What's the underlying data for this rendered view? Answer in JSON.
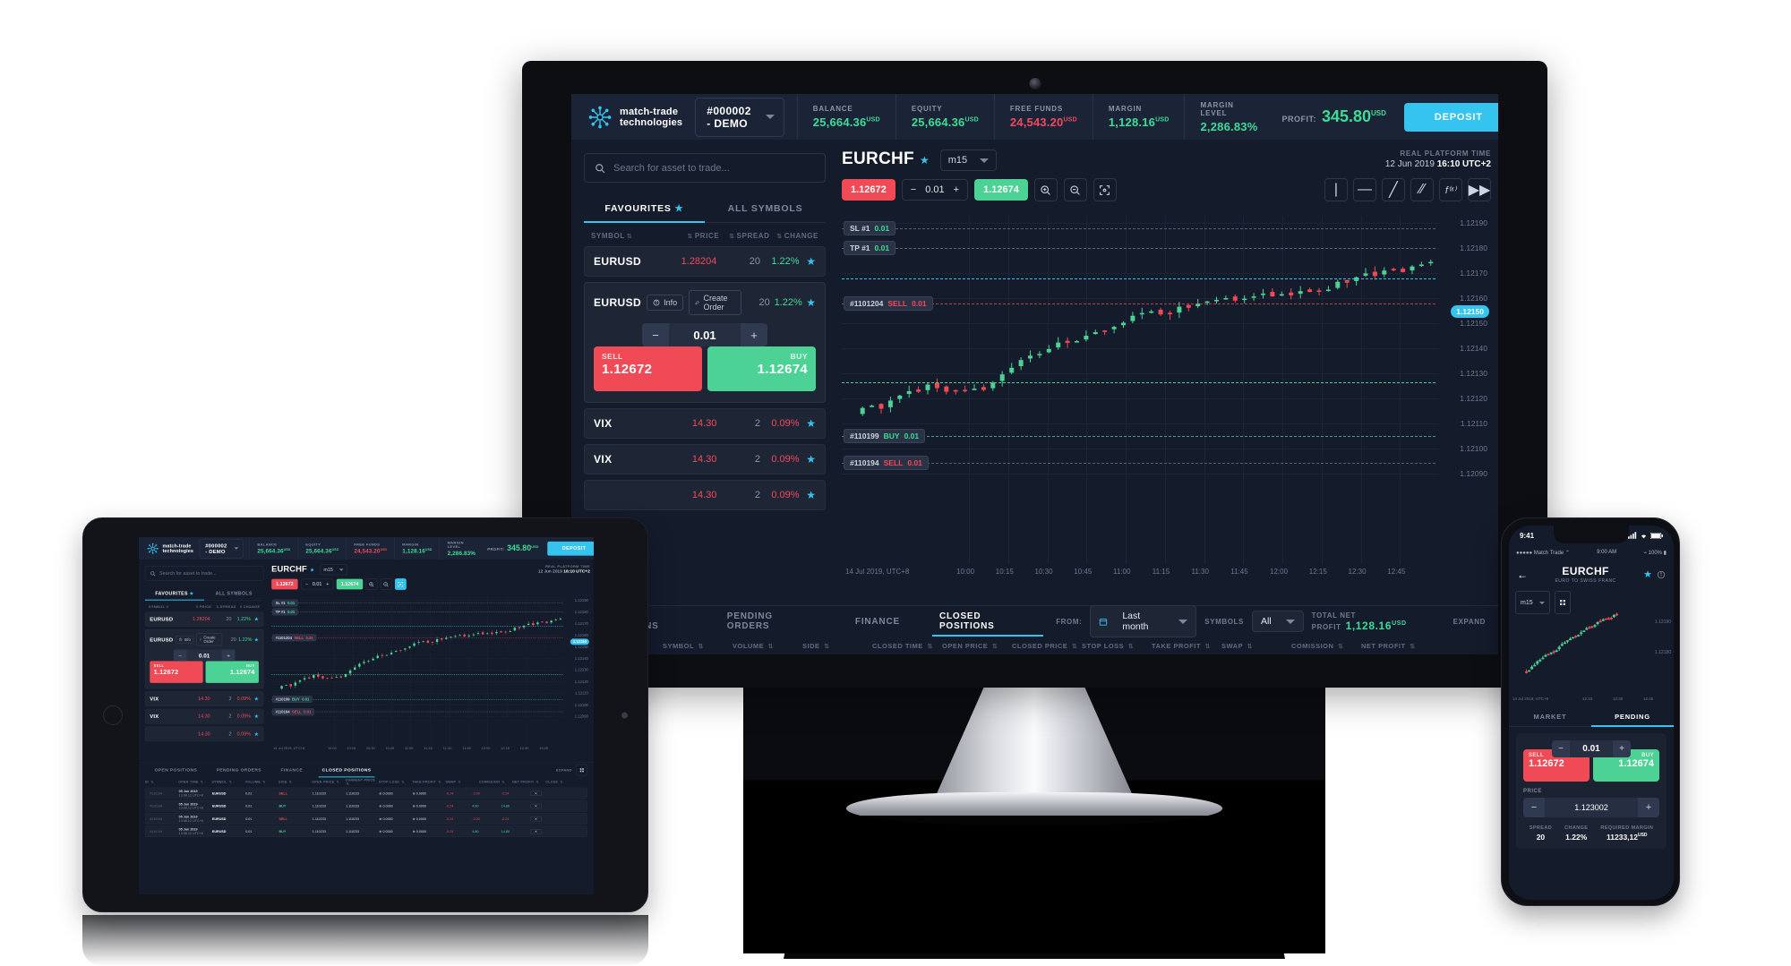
{
  "header": {
    "brand_line1": "match-trade",
    "brand_line2": "technologies",
    "account": "#000002 - DEMO",
    "kpis": [
      {
        "label": "BALANCE",
        "value": "25,664.36",
        "unit": "USD",
        "color": "green"
      },
      {
        "label": "EQUITY",
        "value": "25,664.36",
        "unit": "USD",
        "color": "green"
      },
      {
        "label": "FREE FUNDS",
        "value": "24,543.20",
        "unit": "USD",
        "color": "red"
      },
      {
        "label": "MARGIN",
        "value": "1,128.16",
        "unit": "USD",
        "color": "green"
      },
      {
        "label": "MARGIN LEVEL",
        "value": "2,286.83%",
        "unit": "",
        "color": "green"
      }
    ],
    "profit_label": "PROFIT:",
    "profit_value": "345.80",
    "profit_unit": "USD",
    "deposit_label": "DEPOSIT"
  },
  "sidebar": {
    "search_placeholder": "Search for asset to trade...",
    "tabs": [
      {
        "label": "FAVOURITES",
        "active": true,
        "star": true
      },
      {
        "label": "ALL SYMBOLS",
        "active": false,
        "star": false
      }
    ],
    "columns": [
      "SYMBOL",
      "PRICE",
      "SPREAD",
      "CHANGE"
    ],
    "rows": [
      {
        "symbol": "EURUSD",
        "price": "1.28204",
        "price_color": "red",
        "spread": "20",
        "change": "1.22%",
        "change_color": "green"
      },
      {
        "symbol": "VIX",
        "price": "14.30",
        "price_color": "red",
        "spread": "2",
        "change": "0.09%",
        "change_color": "red"
      },
      {
        "symbol": "VIX",
        "price": "14.30",
        "price_color": "red",
        "spread": "2",
        "change": "0.09%",
        "change_color": "red"
      },
      {
        "symbol": "",
        "price": "14.30",
        "price_color": "red",
        "spread": "2",
        "change": "0.09%",
        "change_color": "red"
      }
    ],
    "expanded": {
      "symbol": "EURUSD",
      "info_label": "Info",
      "create_order_label": "Create Order",
      "spread": "20",
      "change": "1.22%",
      "quantity": "0.01",
      "sell_label": "SELL",
      "sell_price": "1.12672",
      "buy_label": "BUY",
      "buy_price": "1.12674"
    }
  },
  "chart": {
    "symbol": "EURCHF",
    "timeframe": "m15",
    "platform_time_label": "REAL PLATFORM TIME",
    "platform_date": "12 Jun 2019",
    "platform_clock": "16:10 UTC+2",
    "sell_pill": "1.12672",
    "buy_pill": "1.12674",
    "quantity": "0.01",
    "price_ticks": [
      "1.12190",
      "1.12180",
      "1.12170",
      "1.12160",
      "1.12150",
      "1.12140",
      "1.12130",
      "1.12120",
      "1.12110",
      "1.12100",
      "1.12090"
    ],
    "live_price": "1.12150",
    "time_origin": "14 Jul 2019, UTC+8",
    "time_ticks": [
      "10:00",
      "10:15",
      "10:30",
      "10:45",
      "11:00",
      "11:15",
      "11:30",
      "11:45",
      "12:00",
      "12:15",
      "12:30",
      "12:45"
    ],
    "markers": [
      {
        "tag": "SL #1",
        "value": "0.01",
        "value_color": "green"
      },
      {
        "tag": "TP #1",
        "value": "0.01",
        "value_color": "green"
      },
      {
        "tag": "#1101204",
        "side": "SELL",
        "side_color": "red",
        "value": "0.01"
      },
      {
        "tag": "#110199",
        "side": "BUY",
        "side_color": "green",
        "value": "0.01"
      },
      {
        "tag": "#110194",
        "side": "SELL",
        "side_color": "red",
        "value": "0.01"
      }
    ]
  },
  "bottom": {
    "tabs": [
      {
        "label": "OPEN POSITIONS",
        "active": false
      },
      {
        "label": "PENDING ORDERS",
        "active": false
      },
      {
        "label": "FINANCE",
        "active": false
      },
      {
        "label": "CLOSED POSITIONS",
        "active": true
      }
    ],
    "from_label": "FROM:",
    "from_value": "Last month",
    "symbols_label": "SYMBOLS",
    "symbols_value": "All",
    "total_net_profit_label": "TOTAL NET PROFIT",
    "total_net_profit_value": "1,128.16",
    "total_net_profit_unit": "USD",
    "expand_label": "EXPAND",
    "columns": [
      "OPEN TIME",
      "SYMBOL",
      "VOLUME",
      "SIDE",
      "CLOSED TIME",
      "OPEN PRICE",
      "CLOSED PRICE",
      "STOP LOSS",
      "TAKE PROFIT",
      "SWAP",
      "COMISSION",
      "NET PROFIT"
    ]
  },
  "tablet": {
    "table_columns": [
      "ID",
      "OPEN TIME",
      "SYMBOL",
      "VOLUME",
      "SIDE",
      "OPEN PRICE",
      "CURRENT PRICE",
      "STOP LOSS",
      "TAKE PROFIT",
      "SWAP",
      "COMISSION",
      "NET PROFIT",
      "CLOSE"
    ],
    "table_rows": [
      {
        "id": "#110194",
        "date": "05 Jun 2019",
        "time": "13.08.12 UTC+8",
        "symbol": "EURUSD",
        "volume": "0.01",
        "side": "SELL",
        "open": "1.110233",
        "current": "1.110233",
        "sl": "0.0000",
        "tp": "0.0000",
        "swap": "-0.24",
        "commission": "-2.00",
        "net": "-2.24"
      },
      {
        "id": "#110194",
        "date": "05 Jun 2019",
        "time": "13.08.12 UTC+8",
        "symbol": "EURUSD",
        "volume": "0.01",
        "side": "BUY",
        "open": "1.110233",
        "current": "1.110233",
        "sl": "0.0000",
        "tp": "0.0000",
        "swap": "-0.24",
        "commission": "4.80",
        "net": "14.80"
      },
      {
        "id": "#110194",
        "date": "05 Jun 2019",
        "time": "13.08.12 UTC+8",
        "symbol": "EURUSD",
        "volume": "0.01",
        "side": "SELL",
        "open": "1.110233",
        "current": "1.110233",
        "sl": "0.0000",
        "tp": "0.0000",
        "swap": "-0.24",
        "commission": "-2.00",
        "net": "-2.24"
      },
      {
        "id": "#110194",
        "date": "05 Jun 2019",
        "time": "13.08.12 UTC+8",
        "symbol": "EURUSD",
        "volume": "0.01",
        "side": "BUY",
        "open": "1.110233",
        "current": "1.110233",
        "sl": "0.0000",
        "tp": "0.0000",
        "swap": "-0.24",
        "commission": "4.80",
        "net": "14.80"
      }
    ]
  },
  "phone": {
    "ios_time": "9:41",
    "carrier": "Match Trade",
    "app_time": "9:00 AM",
    "battery": "100%",
    "symbol": "EURCHF",
    "subtitle": "EURO TO SWISS FRANC",
    "timeframe": "m15",
    "time_origin": "14 Jul 2019, UTC+8",
    "time_ticks": [
      "12:15",
      "12:30",
      "12:45"
    ],
    "price_ticks": [
      "1.12190",
      "1.12180"
    ],
    "tabs": [
      {
        "label": "MARKET",
        "active": false
      },
      {
        "label": "PENDING",
        "active": true
      }
    ],
    "quantity": "0.01",
    "sell_label": "SELL",
    "sell_price": "1.12672",
    "buy_label": "BUY",
    "buy_price": "1.12674",
    "price_label": "PRICE",
    "price_value": "1.123002",
    "meta": [
      {
        "label": "SPREAD",
        "value": "20",
        "unit": "",
        "color": "white"
      },
      {
        "label": "CHANGE",
        "value": "1.22%",
        "unit": "",
        "color": "green"
      },
      {
        "label": "REQUIRED MARGIN",
        "value": "11233,12",
        "unit": "USD",
        "color": "white"
      }
    ]
  }
}
